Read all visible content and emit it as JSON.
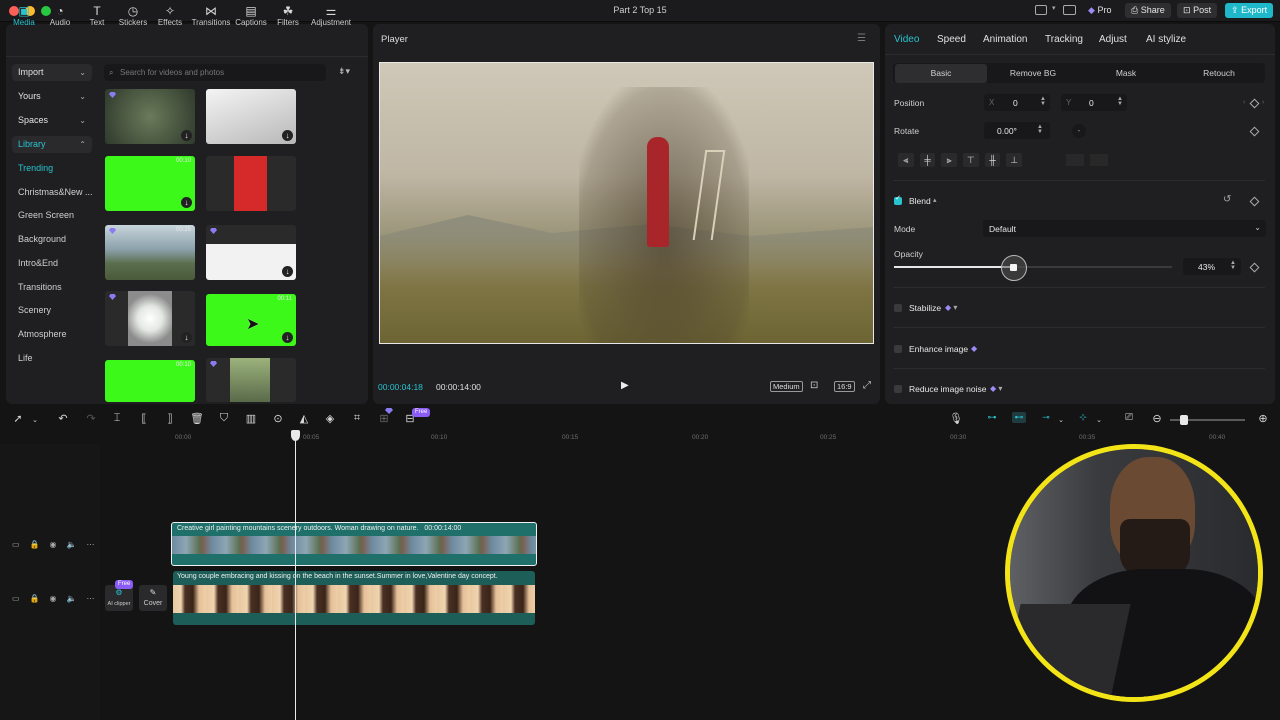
{
  "window": {
    "title": "Part 2 Top 15",
    "pro_label": "Pro",
    "share_label": "Share",
    "post_label": "Post",
    "export_label": "Export"
  },
  "media": {
    "tabs": [
      {
        "label": "Media",
        "icon": "media-icon"
      },
      {
        "label": "Audio",
        "icon": "audio-icon"
      },
      {
        "label": "Text",
        "icon": "text-icon"
      },
      {
        "label": "Stickers",
        "icon": "stickers-icon"
      },
      {
        "label": "Effects",
        "icon": "effects-icon"
      },
      {
        "label": "Transitions",
        "icon": "transitions-icon"
      },
      {
        "label": "Captions",
        "icon": "captions-icon"
      },
      {
        "label": "Filters",
        "icon": "filters-icon"
      },
      {
        "label": "Adjustment",
        "icon": "adjustment-icon"
      }
    ],
    "sidebar_selects": [
      "Import",
      "Yours",
      "Spaces",
      "Library"
    ],
    "library_items": [
      "Trending",
      "Christmas&New ...",
      "Green Screen",
      "Background",
      "Intro&End",
      "Transitions",
      "Scenery",
      "Atmosphere",
      "Life"
    ],
    "search_placeholder": "Search for videos and photos",
    "thumbnails": [
      {
        "duration": ""
      },
      {
        "duration": ""
      },
      {
        "duration": "00:10"
      },
      {
        "duration": ""
      },
      {
        "duration": "00:25"
      },
      {
        "duration": ""
      },
      {
        "duration": ""
      },
      {
        "duration": "00:11"
      },
      {
        "duration": "00:10"
      },
      {
        "duration": ""
      }
    ]
  },
  "player": {
    "title": "Player",
    "current_time": "00:00:04:18",
    "total_time": "00:00:14:00",
    "quality": "Medium",
    "ratio": "16:9"
  },
  "properties": {
    "tabs": [
      "Video",
      "Speed",
      "Animation",
      "Tracking",
      "Adjust",
      "AI stylize"
    ],
    "subtabs": [
      "Basic",
      "Remove BG",
      "Mask",
      "Retouch"
    ],
    "position_label": "Position",
    "x_label": "X",
    "x_value": "0",
    "y_label": "Y",
    "y_value": "0",
    "rotate_label": "Rotate",
    "rotate_value": "0.00°",
    "blend_label": "Blend",
    "mode_label": "Mode",
    "mode_value": "Default",
    "opacity_label": "Opacity",
    "opacity_value": "43%",
    "opacity_fraction": 0.43,
    "stabilize_label": "Stabilize",
    "enhance_label": "Enhance image",
    "noise_label": "Reduce image noise"
  },
  "timeline": {
    "free_badge": "Free",
    "ticks": [
      "00:00",
      "00:05",
      "00:10",
      "00:15",
      "00:20",
      "00:25",
      "00:30",
      "00:35",
      "00:40"
    ],
    "clip1_title": "Creative girl painting mountains scenery outdoors. Woman drawing on nature.",
    "clip1_duration": "00:00:14:00",
    "clip2_title": "Young couple embracing and kissing on the beach in the sunset.Summer in love,Valentine day concept.",
    "ai_clipper_label": "AI clipper",
    "cover_label": "Cover",
    "free_label": "Free"
  },
  "colors": {
    "accent": "#27c3cf",
    "export": "#1fb8cb",
    "webcam_ring": "#f3e418",
    "clip1": "#1f6f6a",
    "clip2": "#1e5e58"
  }
}
